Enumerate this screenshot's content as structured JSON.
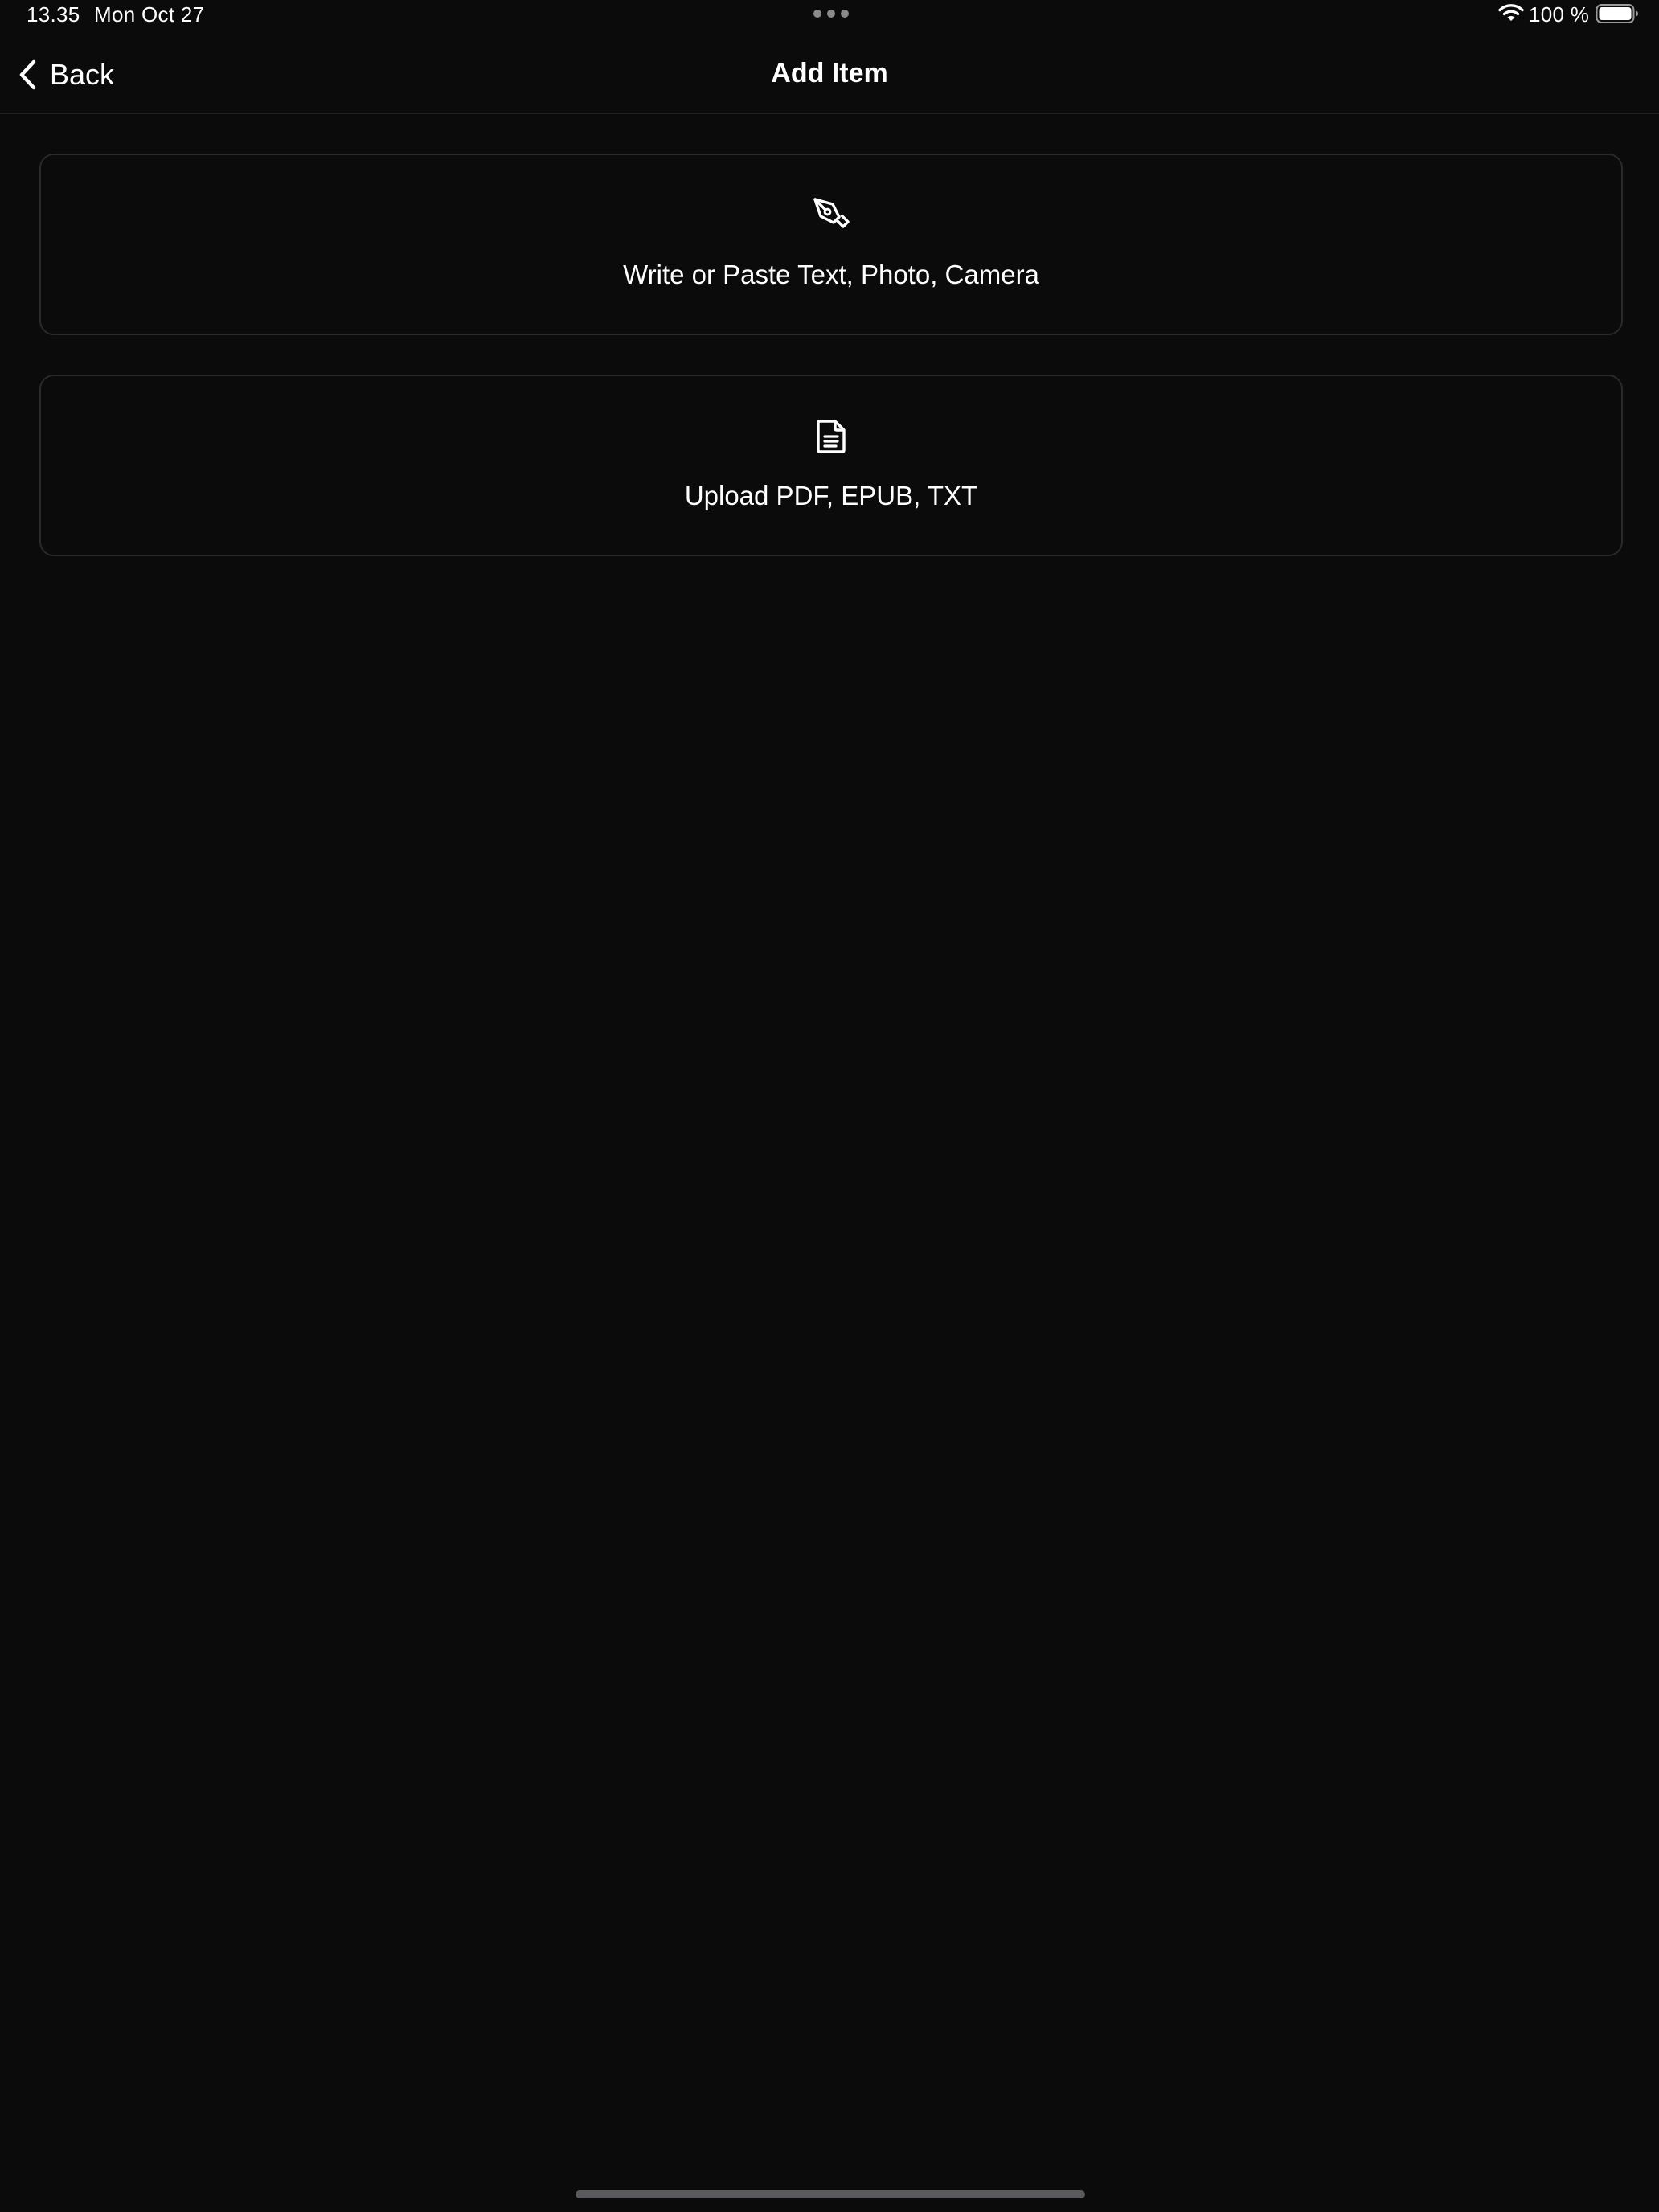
{
  "status_bar": {
    "time": "13.35",
    "date": "Mon Oct 27",
    "battery_percent": "100 %",
    "battery_level": 1.0,
    "icons": [
      "wifi-icon",
      "battery-icon",
      "multitask-dots-icon"
    ]
  },
  "nav": {
    "back_label": "Back",
    "back_icon": "chevron-left-icon",
    "title": "Add Item"
  },
  "options": [
    {
      "label": "Write or Paste Text, Photo, Camera",
      "icon": "pen-nib-icon"
    },
    {
      "label": "Upload PDF, EPUB, TXT",
      "icon": "document-icon"
    }
  ],
  "colors": {
    "background": "#0b0b0c",
    "card_border": "#2a2a2d",
    "divider": "#1f1f22",
    "text": "#ffffff",
    "muted": "#8a8a8e"
  }
}
